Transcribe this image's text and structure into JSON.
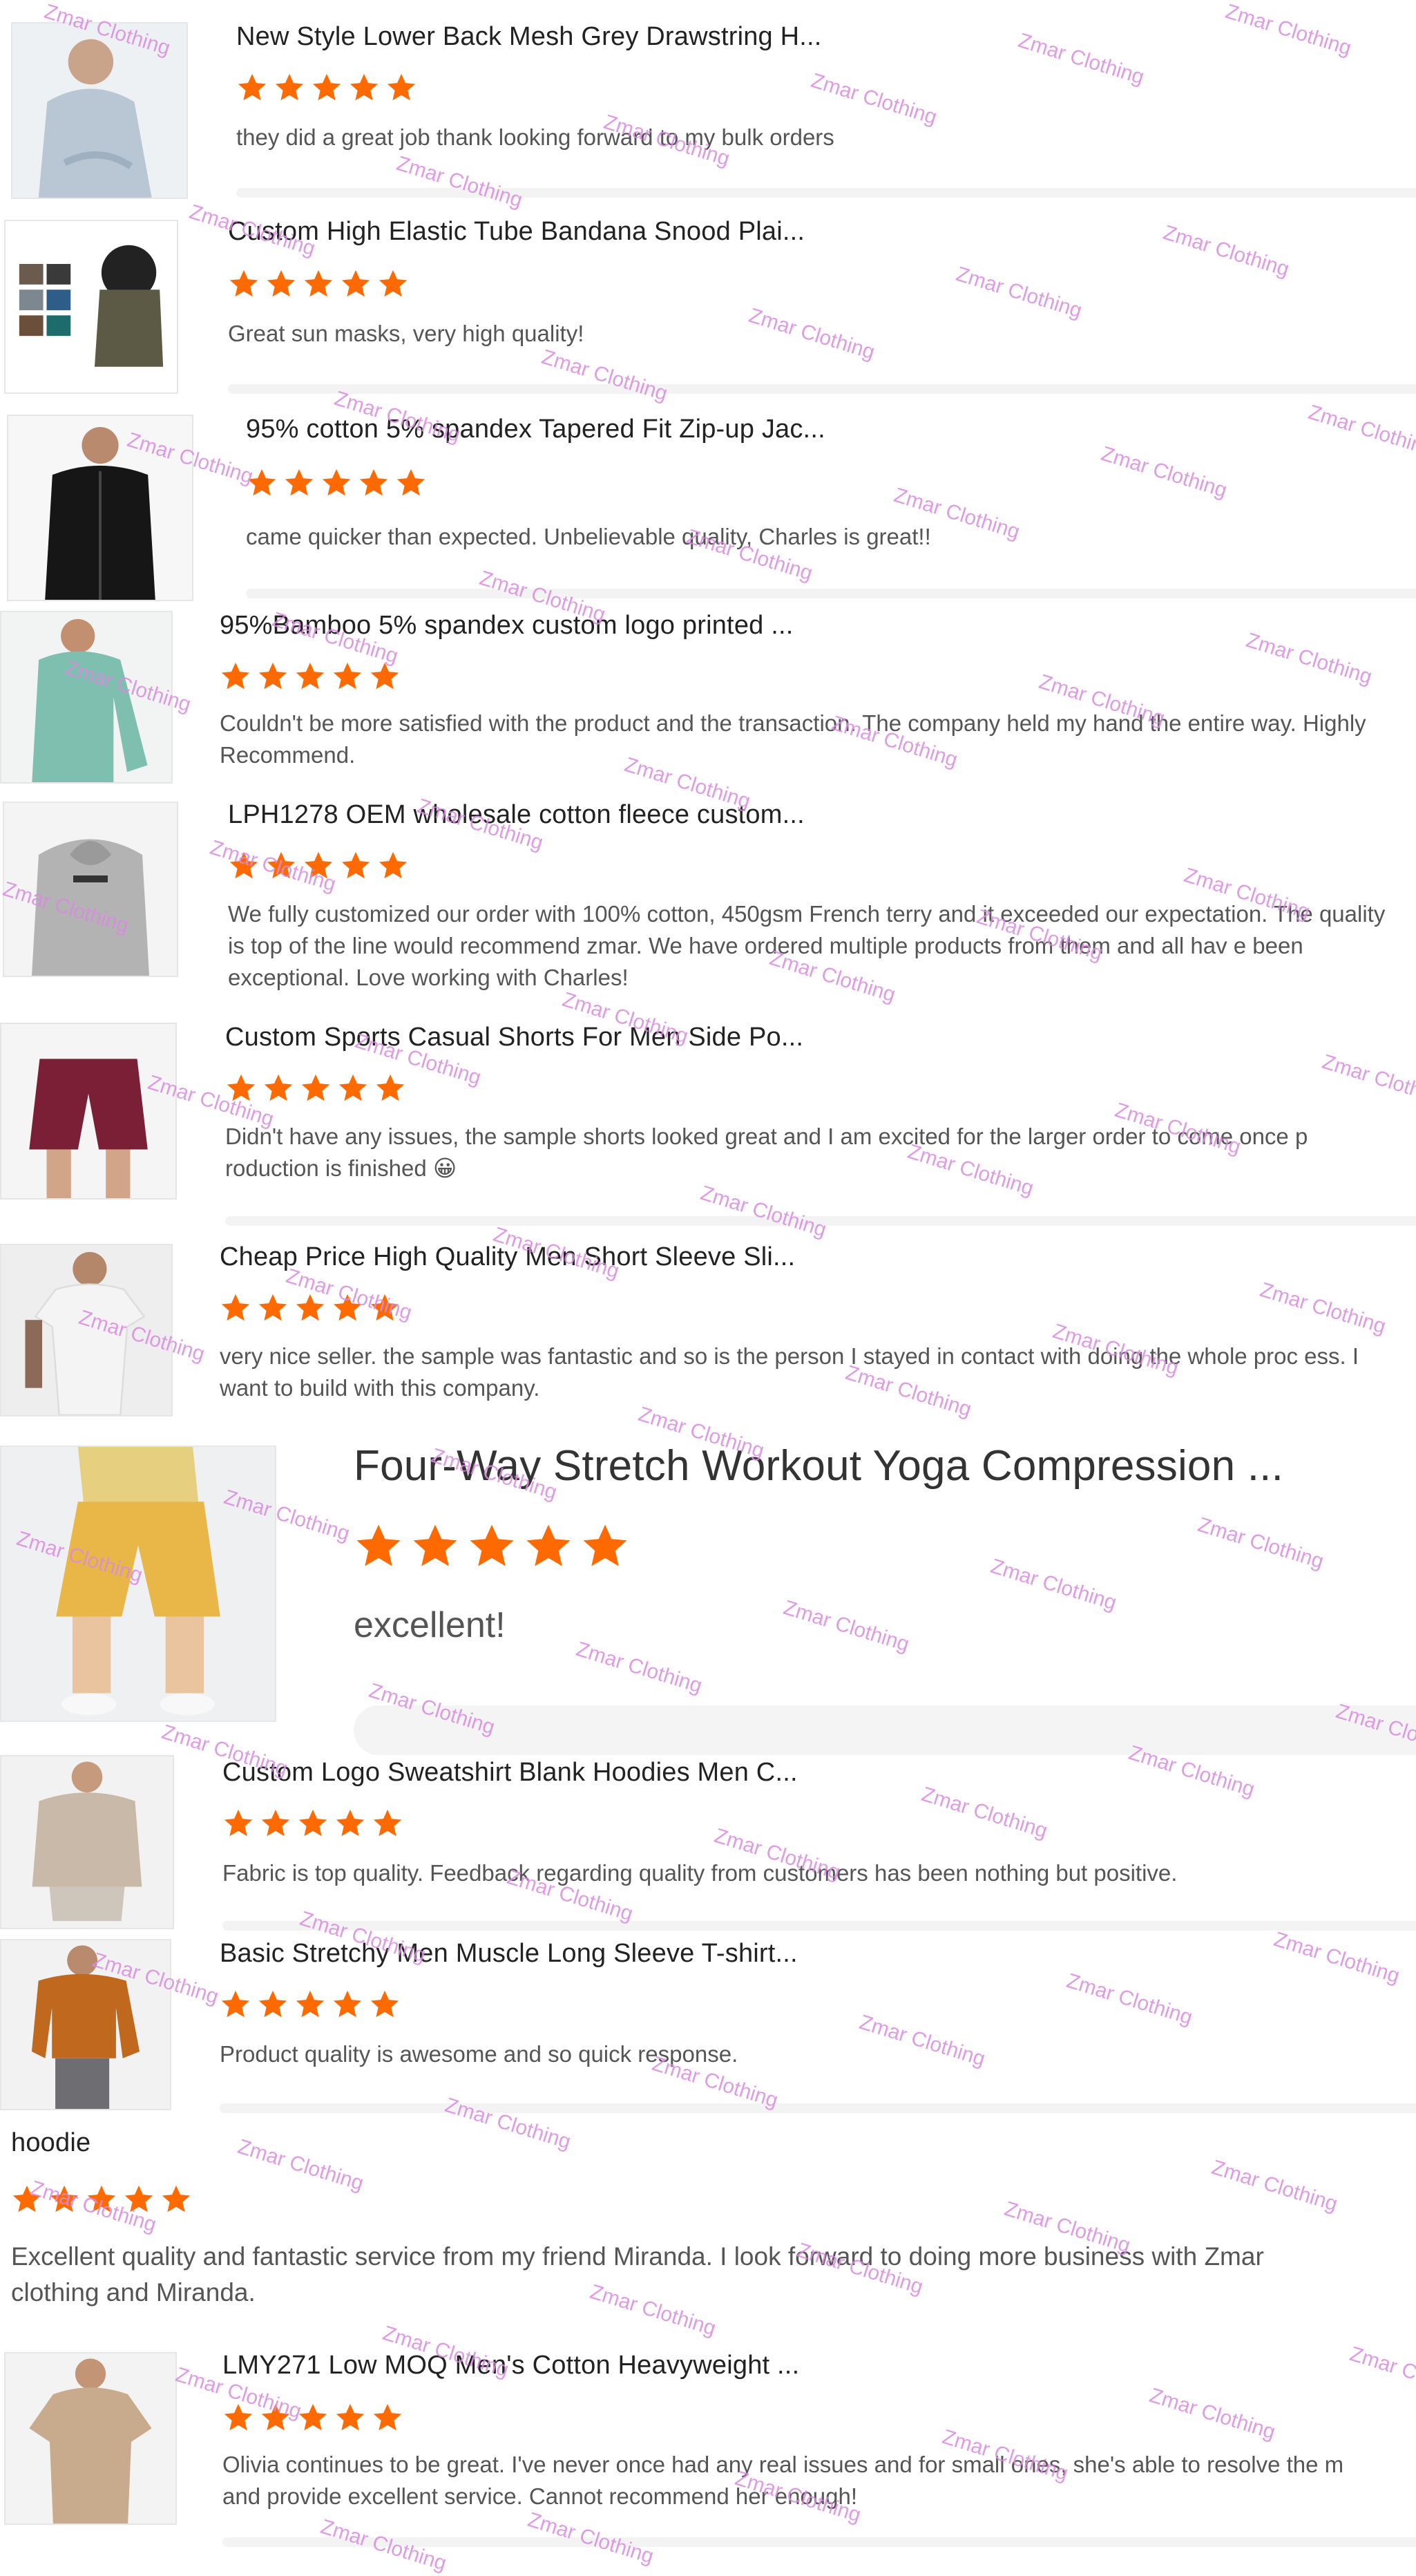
{
  "brand": {
    "star_color": "#ff6a00",
    "watermark_color": "#d98be0"
  },
  "watermark_text": "Zmar Clothing",
  "reviews": [
    {
      "title": "New Style Lower Back Mesh Grey Drawstring H...",
      "rating": 5,
      "text": "they did a great job thank looking forward to my bulk orders"
    },
    {
      "title": "Custom High Elastic Tube Bandana Snood Plai...",
      "rating": 5,
      "text": "Great sun masks, very high quality!"
    },
    {
      "title": "95% cotton 5% spandex Tapered Fit Zip-up Jac...",
      "rating": 5,
      "text": "came quicker than expected. Unbelievable quality, Charles is great!!"
    },
    {
      "title": "95%Bamboo 5% spandex custom logo printed ...",
      "rating": 5,
      "text": "Couldn't be more satisfied with the product and the transaction. The company held my hand the entire way. Highly Recommend."
    },
    {
      "title": "LPH1278 OEM wholesale cotton fleece custom...",
      "rating": 5,
      "text": "We fully customized our order with 100% cotton, 450gsm French terry and it exceeded our expectation. The quality is top of the line would recommend zmar. We have ordered multiple products from them and all hav e been exceptional. Love working with Charles!"
    },
    {
      "title": "Custom Sports Casual Shorts For Men Side Po...",
      "rating": 5,
      "text": "Didn't have any issues, the sample shorts looked great and I am excited for the larger order to come once p roduction is finished 😀"
    },
    {
      "title": "Cheap Price High Quality Men Short Sleeve Sli...",
      "rating": 5,
      "text": "very nice seller. the sample was fantastic and so is the person I stayed in contact with doing the whole proc ess. I want to build with this company."
    },
    {
      "title": "Four-Way Stretch Workout Yoga Compression ...",
      "rating": 5,
      "text": "excellent!"
    },
    {
      "title": "Custom Logo Sweatshirt Blank Hoodies Men C...",
      "rating": 5,
      "text": "Fabric is top quality. Feedback regarding quality from customers has been nothing but positive."
    },
    {
      "title": "Basic Stretchy Men Muscle Long Sleeve T-shirt...",
      "rating": 5,
      "text": "Product quality is awesome and so quick response."
    },
    {
      "title": "hoodie",
      "rating": 5,
      "text": "Excellent quality and fantastic service from my friend  Miranda. I look forward to doing more business with Zmar clothing and Miranda."
    },
    {
      "title": "LMY271 Low MOQ Men's Cotton Heavyweight ...",
      "rating": 5,
      "text": "Olivia continues to be great. I've never once had any real issues and for small ones, she's able to resolve the m and provide excellent service. Cannot recommend her enough!"
    }
  ]
}
